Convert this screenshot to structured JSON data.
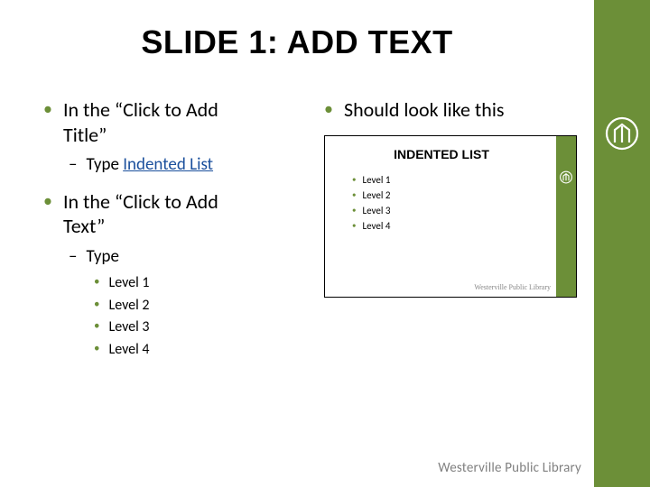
{
  "title": "SLIDE 1: ADD TEXT",
  "left": {
    "b1_pre": "In the “Click to Add ",
    "b1_post": "Title”",
    "b1a_pre": "Type ",
    "b1a_link": "Indented List",
    "b2_pre": "In the “Click to Add ",
    "b2_post": "Text”",
    "b2a": "Type",
    "levels": [
      "Level 1",
      "Level 2",
      "Level 3",
      "Level 4"
    ]
  },
  "right": {
    "b1": "Should look like this"
  },
  "preview": {
    "title": "INDENTED LIST",
    "items": [
      "Level 1",
      "Level 2",
      "Level 3",
      "Level 4"
    ],
    "footer": "Westerville Public Library"
  },
  "footer": "Westerville Public Library"
}
